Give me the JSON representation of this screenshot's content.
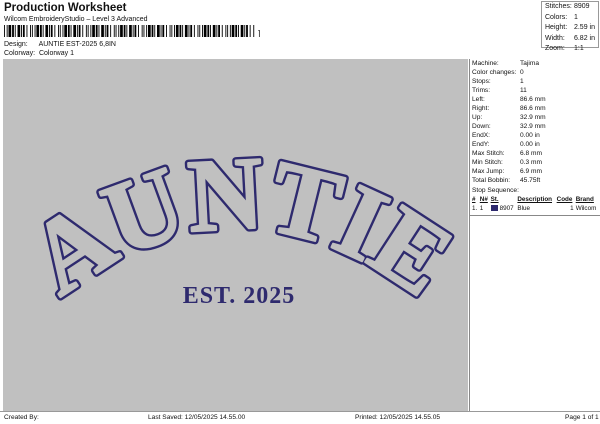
{
  "header": {
    "title": "Production Worksheet",
    "subtitle": "Wilcom EmbroideryStudio – Level 3 Advanced",
    "barcode_end_mark": "]"
  },
  "design": {
    "label": "Design:",
    "value": "AUNTIE EST-2025 6,8IN"
  },
  "colorway": {
    "label": "Colorway:",
    "value": "Colorway 1"
  },
  "stats": [
    {
      "key": "Stitches:",
      "value": "8909"
    },
    {
      "key": "Colors:",
      "value": "1"
    },
    {
      "key": "Height:",
      "value": "2.59 in"
    },
    {
      "key": "Width:",
      "value": "6.82 in"
    },
    {
      "key": "Zoom:",
      "value": "1:1"
    }
  ],
  "artwork": {
    "main_text": "AUNTIE",
    "sub_text": "EST. 2025",
    "thread_color": "#2e2a6e",
    "background_color": "#c0c0c0"
  },
  "properties": [
    {
      "key": "Machine:",
      "value": "Tajima"
    },
    {
      "key": "Color changes:",
      "value": "0"
    },
    {
      "key": "Stops:",
      "value": "1"
    },
    {
      "key": "Trims:",
      "value": "11"
    },
    {
      "key": "Left:",
      "value": "86.6 mm"
    },
    {
      "key": "Right:",
      "value": "86.6 mm"
    },
    {
      "key": "Up:",
      "value": "32.9 mm"
    },
    {
      "key": "Down:",
      "value": "32.9 mm"
    },
    {
      "key": "EndX:",
      "value": "0.00 in"
    },
    {
      "key": "EndY:",
      "value": "0.00 in"
    },
    {
      "key": "Max Stitch:",
      "value": "6.8 mm"
    },
    {
      "key": "Min Stitch:",
      "value": "0.3 mm"
    },
    {
      "key": "Max Jump:",
      "value": "6.9 mm"
    },
    {
      "key": "Total Bobbin:",
      "value": "45.75ft"
    }
  ],
  "stop_sequence": {
    "title": "Stop Sequence:",
    "headers": [
      "#",
      "N#",
      "St.",
      "Description",
      "Code",
      "Brand"
    ],
    "rows": [
      {
        "num": "1.",
        "needle": "1",
        "stitches": "8907",
        "description": "Blue",
        "code": "1",
        "brand": "Wilcom",
        "color": "#2e2a6e"
      }
    ]
  },
  "footer": {
    "created_by": "Created By:",
    "last_saved": "Last Saved: 12/05/2025 14.55.00",
    "printed": "Printed: 12/05/2025 14.55.05",
    "page": "Page 1 of 1"
  }
}
